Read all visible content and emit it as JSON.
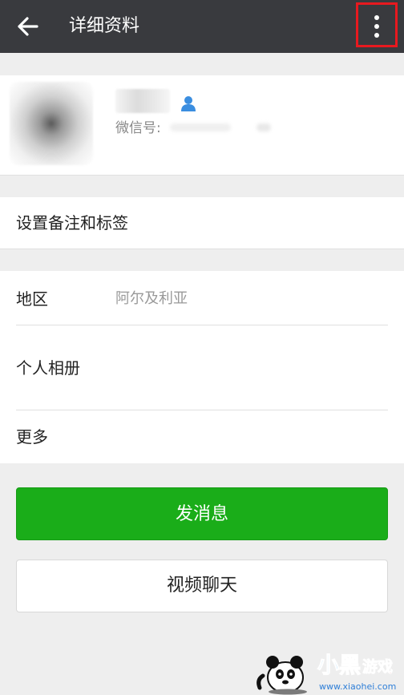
{
  "header": {
    "title": "详细资料"
  },
  "profile": {
    "wechat_id_label": "微信号:"
  },
  "rows": {
    "remark_tags": "设置备注和标签",
    "region_label": "地区",
    "region_value": "阿尔及利亚",
    "album": "个人相册",
    "more": "更多"
  },
  "buttons": {
    "send_message": "发消息",
    "video_chat": "视频聊天"
  },
  "icons": {
    "back": "back-arrow-icon",
    "menu": "more-vertical-icon",
    "contact": "person-icon",
    "watermark": "panda-logo-icon"
  },
  "colors": {
    "topbar": "#393a3e",
    "primary_green": "#1aad19",
    "highlight_red": "#e8191f",
    "contact_icon_blue": "#3b8ee0"
  },
  "watermark": {
    "brand": "小黑游戏",
    "url": "www.xiaohei.com"
  }
}
